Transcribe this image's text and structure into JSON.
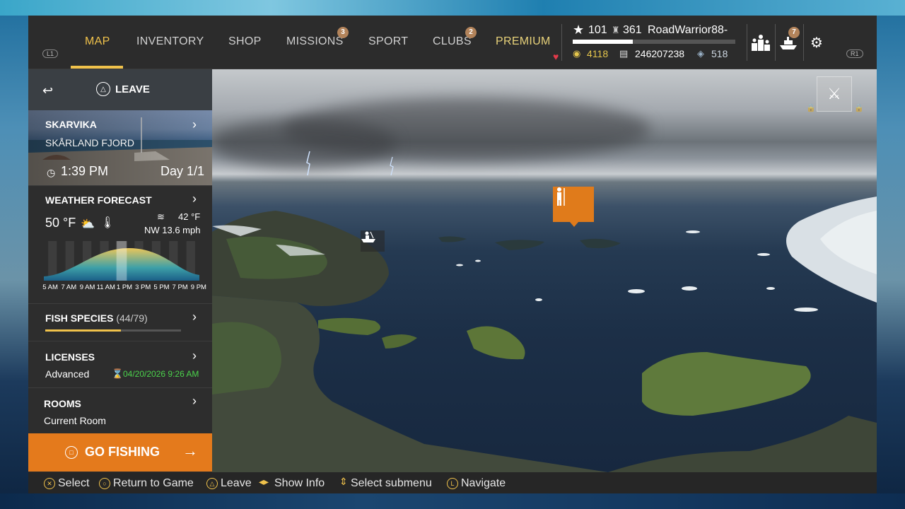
{
  "nav": {
    "left_trigger": "L1",
    "right_trigger": "R1",
    "tabs": [
      {
        "label": "MAP",
        "active": true
      },
      {
        "label": "INVENTORY"
      },
      {
        "label": "SHOP"
      },
      {
        "label": "MISSIONS",
        "badge": "3"
      },
      {
        "label": "SPORT"
      },
      {
        "label": "CLUBS",
        "badge": "2"
      },
      {
        "label": "PREMIUM"
      }
    ]
  },
  "profile": {
    "level": "101",
    "rank": "361",
    "username": "RoadWarrior88-",
    "xp_progress": 0.37,
    "gold": "4118",
    "silver": "246207238",
    "bait_coins": "518",
    "notifications_badge": "7"
  },
  "panel": {
    "leave_label": "LEAVE",
    "location": {
      "name": "SKARVIKA",
      "region": "SKÅRLAND FJORD",
      "time": "1:39 PM",
      "day": "Day 1/1"
    },
    "weather": {
      "title": "WEATHER FORECAST",
      "air_temp": "50 °F",
      "water_temp": "42 °F",
      "wind": "NW 13.6 mph",
      "hours": [
        "5 AM",
        "7 AM",
        "9 AM",
        "11 AM",
        "1 PM",
        "3 PM",
        "5 PM",
        "7 PM",
        "9 PM"
      ],
      "current_hour_index": 4
    },
    "fish_species": {
      "title": "FISH SPECIES",
      "count": "(44/79)",
      "progress": 0.557
    },
    "licenses": {
      "title": "LICENSES",
      "type": "Advanced",
      "expires": "04/20/2026 9:26 AM"
    },
    "rooms": {
      "title": "ROOMS",
      "current": "Current Room"
    },
    "go_fishing": "GO FISHING"
  },
  "hints": [
    {
      "icon": "cross-button-icon",
      "label": "Select"
    },
    {
      "icon": "circle-button-icon",
      "label": "Return to Game"
    },
    {
      "icon": "triangle-button-icon",
      "label": "Leave"
    },
    {
      "icon": "dpad-lr-icon",
      "label": "Show Info"
    },
    {
      "icon": "dpad-ud-icon",
      "label": "Select submenu"
    },
    {
      "icon": "left-stick-icon",
      "label": "Navigate"
    }
  ],
  "colors": {
    "accent": "#f0c24b",
    "go_fishing": "#e47a1c",
    "license_green": "#4bd24b",
    "badge": "#b2835a"
  }
}
